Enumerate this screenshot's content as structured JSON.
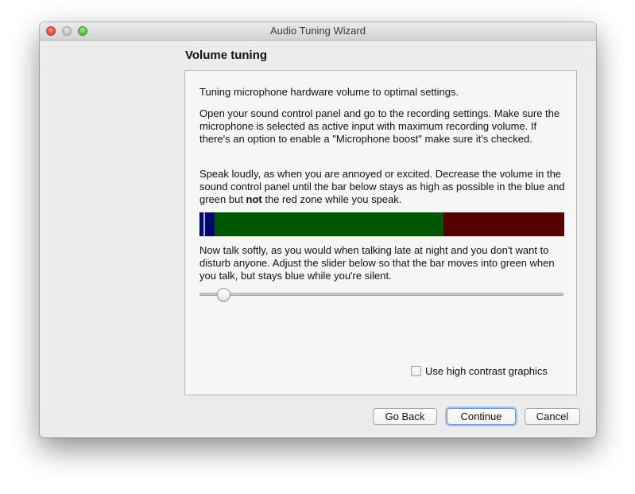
{
  "window": {
    "title": "Audio Tuning Wizard"
  },
  "page": {
    "heading": "Volume tuning",
    "paragraph1": "Tuning microphone hardware volume to optimal settings.",
    "paragraph2": "Open your sound control panel and go to the recording settings. Make sure the microphone is selected as active input with maximum recording volume. If there's an option to enable a \"Microphone boost\" make sure it's checked.",
    "paragraph3_start": "Speak loudly, as when you are annoyed or excited. Decrease the volume in the sound control panel until the bar below stays as high as possible in the blue and green but ",
    "paragraph3_bold": "not",
    "paragraph3_end": " the red zone while you speak.",
    "paragraph4": "Now talk softly, as you would when talking late at night and you don't want to disturb anyone. Adjust the slider below so that the bar moves into green when you talk, but stays blue while you're silent.",
    "high_contrast_label": "Use high contrast graphics",
    "high_contrast_checked": false,
    "slider_value_fraction": 0.05
  },
  "meter": {
    "colors": {
      "blue": "#000a6e",
      "green": "#005500",
      "red": "#550000",
      "peak": "#9fb1ff"
    }
  },
  "buttons": {
    "back": "Go Back",
    "continue": "Continue",
    "cancel": "Cancel"
  }
}
